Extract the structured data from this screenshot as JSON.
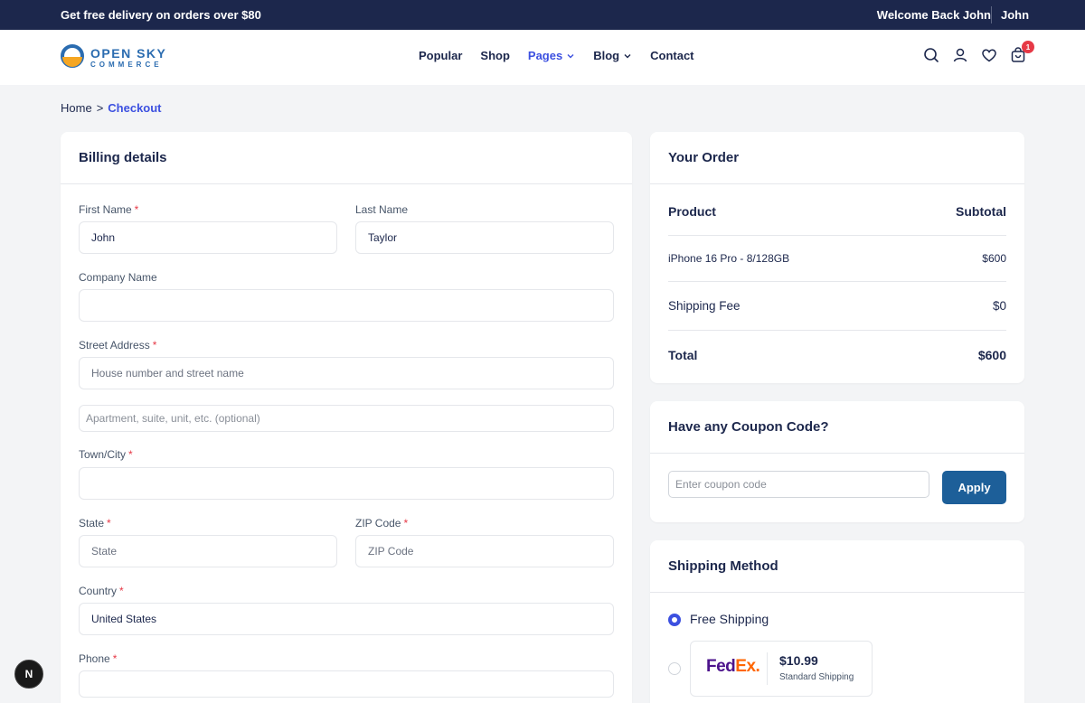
{
  "topbar": {
    "promo": "Get free delivery on orders over $80",
    "welcome": "Welcome Back John",
    "user": "John"
  },
  "logo": {
    "brand": "OPEN SKY",
    "sub": "COMMERCE"
  },
  "nav": {
    "items": [
      {
        "label": "Popular"
      },
      {
        "label": "Shop"
      },
      {
        "label": "Pages"
      },
      {
        "label": "Blog"
      },
      {
        "label": "Contact"
      }
    ]
  },
  "cart": {
    "count": "1"
  },
  "breadcrumb": {
    "home": "Home",
    "separator": ">",
    "current": "Checkout"
  },
  "billing": {
    "title": "Billing details",
    "first_name": {
      "label": "First Name",
      "value": "John"
    },
    "last_name": {
      "label": "Last Name",
      "value": "Taylor"
    },
    "company": {
      "label": "Company Name",
      "value": ""
    },
    "street": {
      "label": "Street Address",
      "placeholder": "House number and street name",
      "placeholder2": "Apartment, suite, unit, etc. (optional)"
    },
    "town": {
      "label": "Town/City",
      "value": ""
    },
    "state": {
      "label": "State",
      "placeholder": "State"
    },
    "zip": {
      "label": "ZIP Code",
      "placeholder": "ZIP Code"
    },
    "country": {
      "label": "Country",
      "value": "United States"
    },
    "phone": {
      "label": "Phone",
      "value": ""
    },
    "required_mark": "*"
  },
  "order": {
    "title": "Your Order",
    "col_product": "Product",
    "col_subtotal": "Subtotal",
    "item_name": "iPhone 16 Pro - 8/128GB",
    "item_price": "$600",
    "shipping_label": "Shipping Fee",
    "shipping_value": "$0",
    "total_label": "Total",
    "total_value": "$600"
  },
  "coupon": {
    "title": "Have any Coupon Code?",
    "placeholder": "Enter coupon code",
    "apply_label": "Apply"
  },
  "shipping": {
    "title": "Shipping Method",
    "options": [
      {
        "label": "Free Shipping",
        "selected": true
      },
      {
        "carrier_fe": "Fed",
        "carrier_ex": "Ex.",
        "price": "$10.99",
        "type": "Standard Shipping",
        "selected": false
      }
    ]
  },
  "floating": {
    "label": "N"
  },
  "colors": {
    "accent": "#3c50e0",
    "dark_navy": "#1c274c",
    "button_blue": "#1d5f99",
    "required_red": "#e63946",
    "fedex_purple": "#4d148c",
    "fedex_orange": "#ff6600"
  }
}
